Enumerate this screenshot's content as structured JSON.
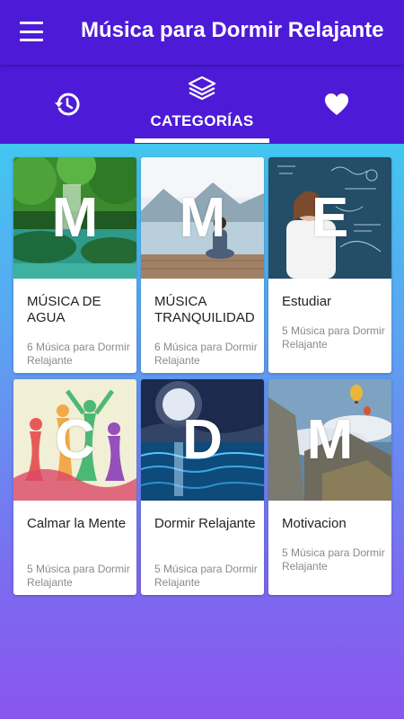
{
  "app": {
    "title": "Música para Dormir Relajante"
  },
  "tabs": [
    {
      "name": "history",
      "icon": "history-icon",
      "label": ""
    },
    {
      "name": "categories",
      "icon": "layers-icon",
      "label": "CATEGORÍAS"
    },
    {
      "name": "favorites",
      "icon": "heart-icon",
      "label": ""
    }
  ],
  "colors": {
    "primary": "#4d1bd8",
    "accent": "#ffffff"
  },
  "categories": [
    {
      "letter": "M",
      "title": "MÚSICA DE AGUA",
      "subtitle": "6 Música para Dormir Relajante",
      "image": "forest-waterfall"
    },
    {
      "letter": "M",
      "title": "MÚSICA TRANQUILIDAD",
      "subtitle": "6 Música para Dormir Relajante",
      "image": "meditation-lake"
    },
    {
      "letter": "E",
      "title": "Estudiar",
      "subtitle": "5 Música para Dormir Relajante",
      "image": "scientist-formulas"
    },
    {
      "letter": "C",
      "title": "Calmar la Mente",
      "subtitle": "5 Música para Dormir Relajante",
      "image": "yoga-silhouettes"
    },
    {
      "letter": "D",
      "title": "Dormir Relajante",
      "subtitle": "5 Música para Dormir Relajante",
      "image": "moon-ocean"
    },
    {
      "letter": "M",
      "title": "Motivacion",
      "subtitle": "5 Música para Dormir Relajante",
      "image": "mountain-balloons"
    }
  ]
}
